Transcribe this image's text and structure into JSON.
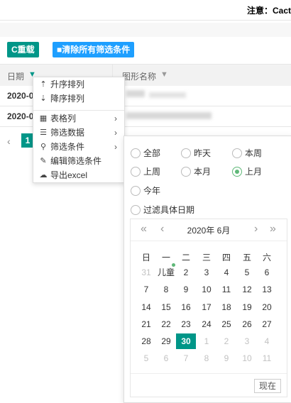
{
  "notice": "注意：Cact",
  "toolbar": {
    "reload_label": "C重载",
    "clear_label": "■清除所有筛选条件"
  },
  "grid": {
    "col_date": "日期",
    "col_shape": "图形名称",
    "rows": [
      {
        "date": "2020-0"
      },
      {
        "date": "2020-0"
      }
    ],
    "page_current": "1"
  },
  "menu": {
    "items": [
      {
        "icon": "sort-asc-icon",
        "label": "升序排列"
      },
      {
        "icon": "sort-desc-icon",
        "label": "降序排列"
      },
      {
        "icon": "table-icon",
        "label": "表格列",
        "arrow": "›"
      },
      {
        "icon": "list-icon",
        "label": "筛选数据",
        "arrow": "›"
      },
      {
        "icon": "filter-search-icon",
        "label": "筛选条件",
        "arrow": "›"
      },
      {
        "icon": "edit-icon",
        "label": "编辑筛选条件"
      },
      {
        "icon": "export-icon",
        "label": "导出excel"
      }
    ]
  },
  "filter": {
    "options": [
      "全部",
      "昨天",
      "本周",
      "上周",
      "本月",
      "上月",
      "今年",
      "过滤具体日期"
    ],
    "selected": "上月"
  },
  "calendar": {
    "header": "2020年  6月",
    "weekdays": [
      "日",
      "一",
      "二",
      "三",
      "四",
      "五",
      "六"
    ],
    "weeks": [
      [
        "31",
        "儿童",
        "2",
        "3",
        "4",
        "5",
        "6"
      ],
      [
        "7",
        "8",
        "9",
        "10",
        "11",
        "12",
        "13"
      ],
      [
        "14",
        "15",
        "16",
        "17",
        "18",
        "19",
        "20"
      ],
      [
        "21",
        "22",
        "23",
        "24",
        "25",
        "26",
        "27"
      ],
      [
        "28",
        "29",
        "30",
        "1",
        "2",
        "3",
        "4"
      ],
      [
        "5",
        "6",
        "7",
        "8",
        "9",
        "10",
        "11"
      ]
    ],
    "selected_day": "30",
    "now_label": "现在"
  },
  "colors": {
    "teal": "#009688",
    "blue": "#1e9fff",
    "green": "#5fb878"
  }
}
